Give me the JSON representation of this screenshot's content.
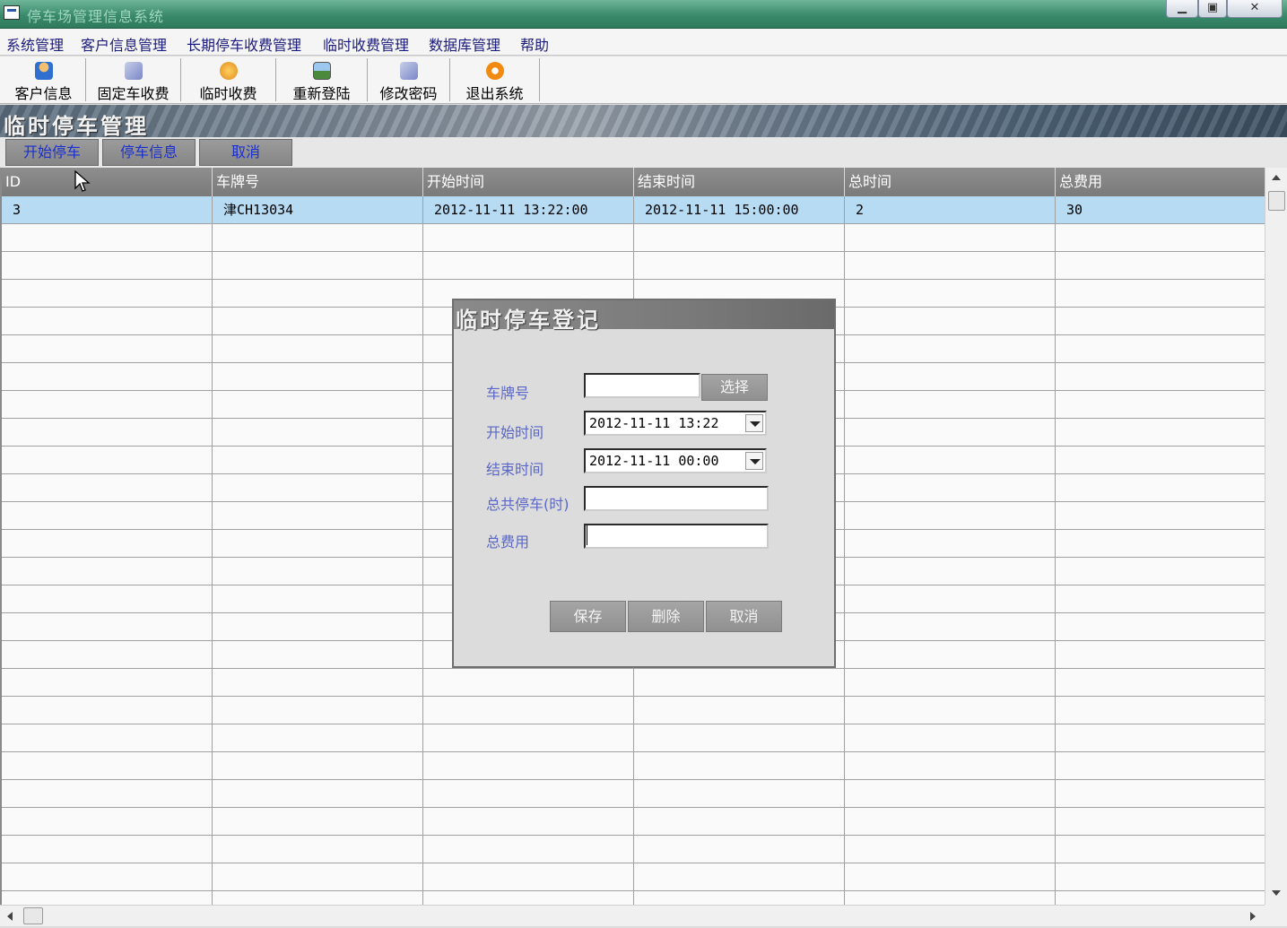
{
  "window": {
    "title": "停车场管理信息系统",
    "min_glyph": "▁",
    "max_glyph": "▣",
    "close_glyph": "✕"
  },
  "menu": [
    "系统管理",
    "客户信息管理",
    "长期停车收费管理",
    "临时收费管理",
    "数据库管理",
    "帮助"
  ],
  "toolbar": [
    {
      "label": "客户信息",
      "icon": "user-icon",
      "color": "#2f6fd0"
    },
    {
      "label": "固定车收费",
      "icon": "parking-pay-icon",
      "color": "#7a86c8"
    },
    {
      "label": "临时收费",
      "icon": "coin-icon",
      "color": "#e08a1a"
    },
    {
      "label": "重新登陆",
      "icon": "picture-icon",
      "color": "#4a8a3a"
    },
    {
      "label": "修改密码",
      "icon": "key-icon",
      "color": "#7a86c8"
    },
    {
      "label": "退出系统",
      "icon": "power-icon",
      "color": "#f08a10"
    }
  ],
  "section_title": "临时停车管理",
  "tabs": [
    "开始停车",
    "停车信息",
    "取消"
  ],
  "table": {
    "columns": [
      "ID",
      "车牌号",
      "开始时间",
      "结束时间",
      "总时间",
      "总费用"
    ],
    "rows": [
      [
        "3",
        "津CH13034",
        "2012-11-11 13:22:00",
        "2012-11-11 15:00:00",
        "2",
        "30"
      ]
    ]
  },
  "dialog": {
    "title": "临时停车登记",
    "plate_label": "车牌号",
    "plate_value": "",
    "select_label": "选择",
    "start_label": "开始时间",
    "start_value": "2012-11-11 13:22",
    "end_label": "结束时间",
    "end_value": "2012-11-11 00:00",
    "hours_label": "总共停车(时)",
    "hours_value": "",
    "fee_label": "总费用",
    "fee_value": "",
    "save_label": "保存",
    "delete_label": "删除",
    "cancel_label": "取消"
  },
  "colors": {
    "title_bar": "#3a8a6c",
    "selected_row": "#b7dbf3",
    "tab_text": "#1a2fd0",
    "dialog_label": "#5a67c8"
  }
}
